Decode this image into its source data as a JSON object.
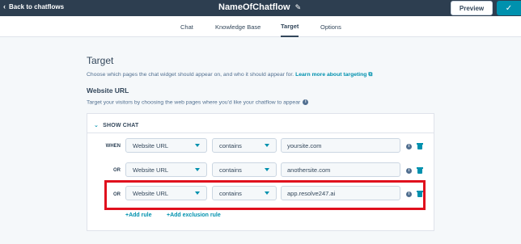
{
  "header": {
    "back_label": "Back to chatflows",
    "title": "NameOfChatflow",
    "preview_label": "Preview",
    "publish_icon": "check-icon"
  },
  "tabs": [
    {
      "label": "Chat",
      "active": false
    },
    {
      "label": "Knowledge Base",
      "active": false
    },
    {
      "label": "Target",
      "active": true
    },
    {
      "label": "Options",
      "active": false
    }
  ],
  "main": {
    "title": "Target",
    "description": "Choose which pages the chat widget should appear on, and who it should appear for.",
    "learn_more": "Learn more about targeting",
    "section_title": "Website URL",
    "section_subtitle": "Target your visitors by choosing the web pages where you'd like your chatflow to appear"
  },
  "card": {
    "header": "SHOW CHAT",
    "rules": [
      {
        "connector": "WHEN",
        "field": "Website URL",
        "operator": "contains",
        "value": "yoursite.com"
      },
      {
        "connector": "OR",
        "field": "Website URL",
        "operator": "contains",
        "value": "anothersite.com"
      },
      {
        "connector": "OR",
        "field": "Website URL",
        "operator": "contains",
        "value": "app.resolve247.ai"
      }
    ],
    "add_rule": "+Add rule",
    "add_exclusion": "+Add exclusion rule"
  },
  "colors": {
    "topbar": "#2d3e50",
    "accent": "#0091ae",
    "highlight": "#e0101d"
  }
}
